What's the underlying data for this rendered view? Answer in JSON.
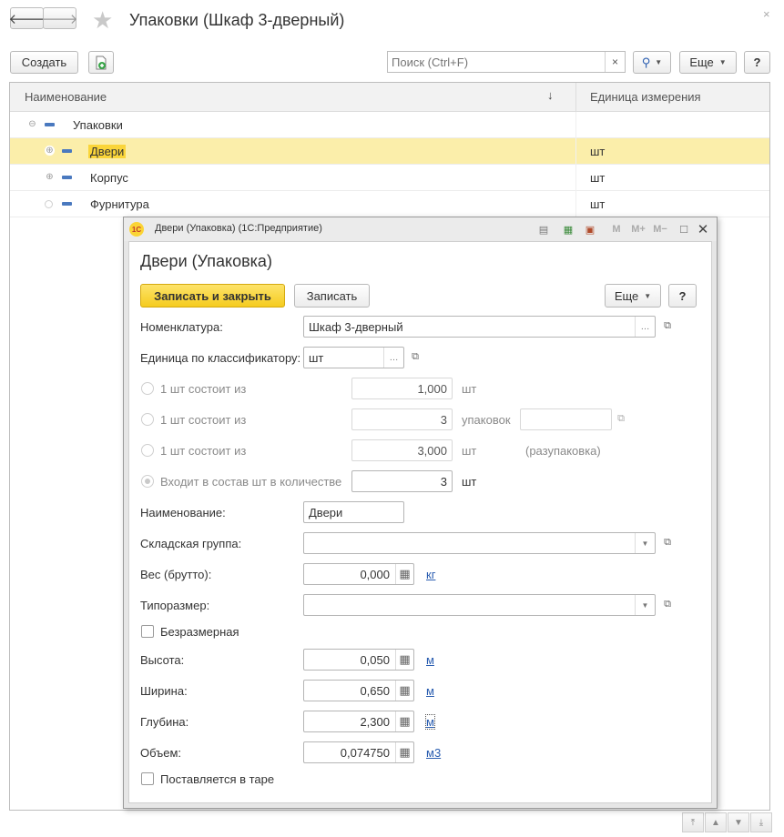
{
  "window": {
    "title": "Упаковки (Шкаф 3-дверный)"
  },
  "toolbar": {
    "create_label": "Создать",
    "search_placeholder": "Поиск (Ctrl+F)",
    "more_label": "Еще",
    "help_label": "?"
  },
  "list": {
    "columns": [
      "Наименование",
      "Единица измерения"
    ],
    "sort_indicator": "↓",
    "rows": [
      {
        "name": "Упаковки",
        "unit": ""
      },
      {
        "name": "Двери",
        "unit": "шт"
      },
      {
        "name": "Корпус",
        "unit": "шт"
      },
      {
        "name": "Фурнитура",
        "unit": "шт"
      }
    ]
  },
  "dialog": {
    "caption": "Двери (Упаковка)  (1С:Предприятие)",
    "logo_text": "1С",
    "heading": "Двери (Упаковка)",
    "save_close_label": "Записать и закрыть",
    "save_label": "Записать",
    "more_label": "Еще",
    "help_label": "?",
    "fields": {
      "nomenclature_label": "Номенклатура:",
      "nomenclature_value": "Шкаф 3-дверный",
      "unit_class_label": "Единица по классификатору:",
      "unit_class_value": "шт",
      "opt1_label": "1 шт состоит из",
      "opt1_value": "1,000",
      "opt1_unit": "шт",
      "opt2_label": "1 шт состоит из",
      "opt2_value": "3",
      "opt2_unit": "упаковок",
      "opt3_label": "1 шт состоит из",
      "opt3_value": "3,000",
      "opt3_unit": "шт",
      "opt3_note": "(разупаковка)",
      "opt4_label": "Входит в состав шт в количестве",
      "opt4_value": "3",
      "opt4_unit": "шт",
      "name_label": "Наименование:",
      "name_value": "Двери",
      "warehouse_group_label": "Складская группа:",
      "warehouse_group_value": "",
      "weight_label": "Вес (брутто):",
      "weight_value": "0,000",
      "weight_unit": "кг",
      "size_type_label": "Типоразмер:",
      "size_type_value": "",
      "dimensionless_label": "Безразмерная",
      "height_label": "Высота:",
      "height_value": "0,050",
      "height_unit": "м",
      "width_label": "Ширина:",
      "width_value": "0,650",
      "width_unit": "м",
      "depth_label": "Глубина:",
      "depth_value": "2,300",
      "depth_unit": "м",
      "volume_label": "Объем:",
      "volume_value": "0,074750",
      "volume_unit": "м3",
      "in_container_label": "Поставляется в таре"
    }
  },
  "colors": {
    "selected_row": "#fbeeaa",
    "primary_button": "#fad53a",
    "link": "#2a5db0",
    "group_marker": "#4a79bf"
  }
}
